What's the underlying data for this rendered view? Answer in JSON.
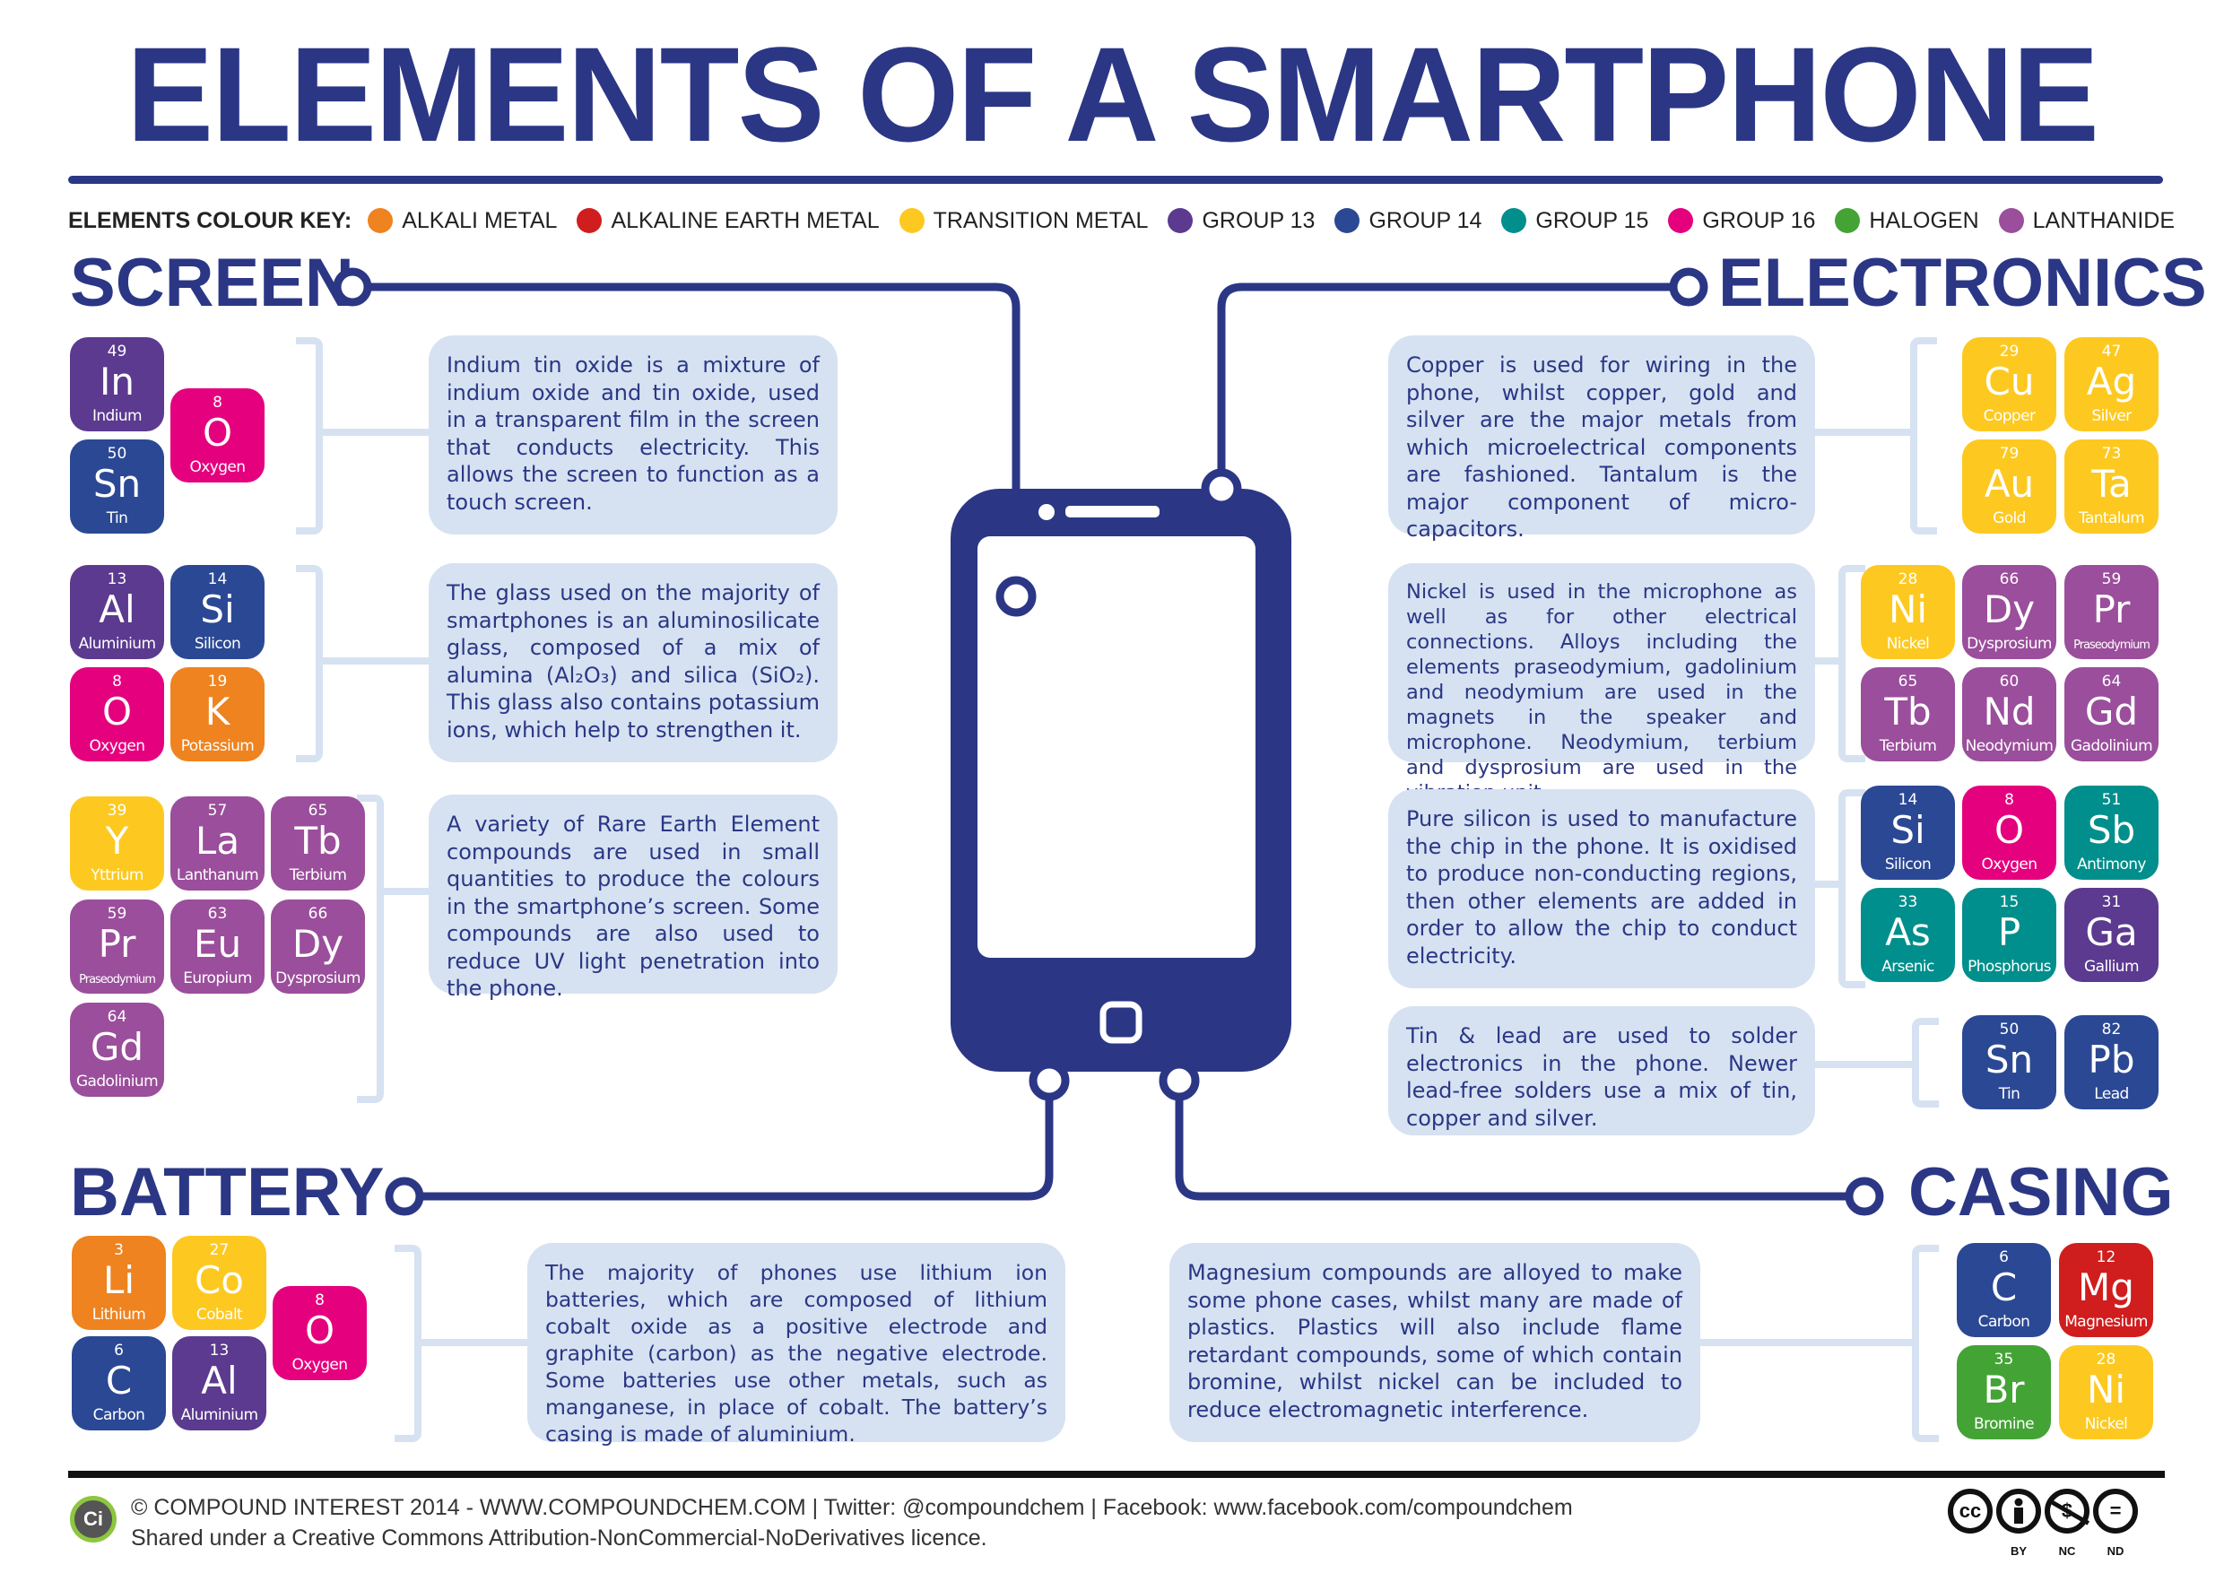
{
  "title": "ELEMENTS OF A SMARTPHONE",
  "colours": {
    "alkali_metal": "#ee8320",
    "alkaline_earth_metal": "#d01d1d",
    "transition_metal": "#fdc921",
    "group_13": "#5b3a8f",
    "group_14": "#2b4894",
    "group_15": "#008f8c",
    "group_16": "#e5007e",
    "halogen": "#44a335",
    "lanthanide": "#9a4e9b",
    "brand": "#2b3785",
    "panel": "#d6e2f1"
  },
  "key": {
    "label": "ELEMENTS COLOUR KEY:",
    "items": [
      {
        "label": "ALKALI METAL",
        "color": "#ee8320"
      },
      {
        "label": "ALKALINE EARTH METAL",
        "color": "#d01d1d"
      },
      {
        "label": "TRANSITION METAL",
        "color": "#fdc921"
      },
      {
        "label": "GROUP 13",
        "color": "#5b3a8f"
      },
      {
        "label": "GROUP 14",
        "color": "#2b4894"
      },
      {
        "label": "GROUP 15",
        "color": "#008f8c"
      },
      {
        "label": "GROUP 16",
        "color": "#e5007e"
      },
      {
        "label": "HALOGEN",
        "color": "#44a335"
      },
      {
        "label": "LANTHANIDE",
        "color": "#9a4e9b"
      }
    ]
  },
  "sections": {
    "screen": {
      "title": "SCREEN",
      "groups": [
        {
          "text": [
            "Indium tin oxide is a mixture of indium oxide and tin oxide, used in a transparent film in the screen that conducts electricity. This allows the screen to function as a touch screen."
          ],
          "elements": [
            {
              "num": "49",
              "sym": "In",
              "name": "Indium",
              "color": "#5b3a8f"
            },
            {
              "num": "50",
              "sym": "Sn",
              "name": "Tin",
              "color": "#2b4894"
            },
            {
              "num": "8",
              "sym": "O",
              "name": "Oxygen",
              "color": "#e5007e"
            }
          ]
        },
        {
          "text": [
            "The glass used on the majority of smartphones is an aluminosilicate glass, composed of a mix of alumina (Al₂O₃) and silica (SiO₂). This glass also contains potassium ions, which help to strengthen it."
          ],
          "elements": [
            {
              "num": "13",
              "sym": "Al",
              "name": "Aluminium",
              "color": "#5b3a8f"
            },
            {
              "num": "14",
              "sym": "Si",
              "name": "Silicon",
              "color": "#2b4894"
            },
            {
              "num": "8",
              "sym": "O",
              "name": "Oxygen",
              "color": "#e5007e"
            },
            {
              "num": "19",
              "sym": "K",
              "name": "Potassium",
              "color": "#ee8320"
            }
          ]
        },
        {
          "text": [
            "A variety of Rare Earth Element compounds are used in small quantities to produce the colours in the smartphone’s screen. Some compounds are also used to reduce UV light penetration into the phone."
          ],
          "elements": [
            {
              "num": "39",
              "sym": "Y",
              "name": "Yttrium",
              "color": "#fdc921"
            },
            {
              "num": "57",
              "sym": "La",
              "name": "Lanthanum",
              "color": "#9a4e9b"
            },
            {
              "num": "65",
              "sym": "Tb",
              "name": "Terbium",
              "color": "#9a4e9b"
            },
            {
              "num": "59",
              "sym": "Pr",
              "name": "Praseodymium",
              "color": "#9a4e9b"
            },
            {
              "num": "63",
              "sym": "Eu",
              "name": "Europium",
              "color": "#9a4e9b"
            },
            {
              "num": "66",
              "sym": "Dy",
              "name": "Dysprosium",
              "color": "#9a4e9b"
            },
            {
              "num": "64",
              "sym": "Gd",
              "name": "Gadolinium",
              "color": "#9a4e9b"
            }
          ]
        }
      ]
    },
    "electronics": {
      "title": "ELECTRONICS",
      "groups": [
        {
          "text": [
            "Copper is used for wiring in the phone, whilst copper, gold and silver are the major metals from which microelectrical components are fashioned. Tantalum is the major component of micro-capacitors."
          ],
          "elements": [
            {
              "num": "29",
              "sym": "Cu",
              "name": "Copper",
              "color": "#fdc921"
            },
            {
              "num": "47",
              "sym": "Ag",
              "name": "Silver",
              "color": "#fdc921"
            },
            {
              "num": "79",
              "sym": "Au",
              "name": "Gold",
              "color": "#fdc921"
            },
            {
              "num": "73",
              "sym": "Ta",
              "name": "Tantalum",
              "color": "#fdc921"
            }
          ]
        },
        {
          "text": [
            "Nickel is used in the microphone as well as for other electrical connections. Alloys including the elements praseodymium, gadolinium and neodymium are used in the magnets in the speaker and microphone. Neodymium, terbium and dysprosium are used in the vibration unit."
          ],
          "elements": [
            {
              "num": "28",
              "sym": "Ni",
              "name": "Nickel",
              "color": "#fdc921"
            },
            {
              "num": "66",
              "sym": "Dy",
              "name": "Dysprosium",
              "color": "#9a4e9b"
            },
            {
              "num": "59",
              "sym": "Pr",
              "name": "Praseodymium",
              "color": "#9a4e9b"
            },
            {
              "num": "65",
              "sym": "Tb",
              "name": "Terbium",
              "color": "#9a4e9b"
            },
            {
              "num": "60",
              "sym": "Nd",
              "name": "Neodymium",
              "color": "#9a4e9b"
            },
            {
              "num": "64",
              "sym": "Gd",
              "name": "Gadolinium",
              "color": "#9a4e9b"
            }
          ]
        },
        {
          "text": [
            "Pure silicon is used to manufacture the chip in the phone. It is oxidised to produce non-conducting regions, then other elements are added in order to allow the chip to conduct electricity."
          ],
          "elements": [
            {
              "num": "14",
              "sym": "Si",
              "name": "Silicon",
              "color": "#2b4894"
            },
            {
              "num": "8",
              "sym": "O",
              "name": "Oxygen",
              "color": "#e5007e"
            },
            {
              "num": "51",
              "sym": "Sb",
              "name": "Antimony",
              "color": "#008f8c"
            },
            {
              "num": "33",
              "sym": "As",
              "name": "Arsenic",
              "color": "#008f8c"
            },
            {
              "num": "15",
              "sym": "P",
              "name": "Phosphorus",
              "color": "#008f8c"
            },
            {
              "num": "31",
              "sym": "Ga",
              "name": "Gallium",
              "color": "#5b3a8f"
            }
          ]
        },
        {
          "text": [
            "Tin & lead are used to solder electronics in the phone. Newer lead-free solders use a mix of tin, copper and silver."
          ],
          "elements": [
            {
              "num": "50",
              "sym": "Sn",
              "name": "Tin",
              "color": "#2b4894"
            },
            {
              "num": "82",
              "sym": "Pb",
              "name": "Lead",
              "color": "#2b4894"
            }
          ]
        }
      ]
    },
    "battery": {
      "title": "BATTERY",
      "groups": [
        {
          "text": [
            "The majority of phones use lithium ion batteries, which are composed of lithium cobalt oxide as a positive electrode and graphite (carbon) as the negative electrode. Some batteries use other metals, such as manganese, in place of cobalt. The battery’s casing is made of aluminium."
          ],
          "elements": [
            {
              "num": "3",
              "sym": "Li",
              "name": "Lithium",
              "color": "#ee8320"
            },
            {
              "num": "27",
              "sym": "Co",
              "name": "Cobalt",
              "color": "#fdc921"
            },
            {
              "num": "6",
              "sym": "C",
              "name": "Carbon",
              "color": "#2b4894"
            },
            {
              "num": "13",
              "sym": "Al",
              "name": "Aluminium",
              "color": "#5b3a8f"
            },
            {
              "num": "8",
              "sym": "O",
              "name": "Oxygen",
              "color": "#e5007e"
            }
          ]
        }
      ]
    },
    "casing": {
      "title": "CASING",
      "groups": [
        {
          "text": [
            "Magnesium compounds are alloyed to make some phone cases, whilst many are made of plastics. Plastics will also include flame retardant compounds, some of which contain bromine, whilst nickel can be included to reduce electromagnetic interference."
          ],
          "elements": [
            {
              "num": "6",
              "sym": "C",
              "name": "Carbon",
              "color": "#2b4894"
            },
            {
              "num": "12",
              "sym": "Mg",
              "name": "Magnesium",
              "color": "#d01d1d"
            },
            {
              "num": "35",
              "sym": "Br",
              "name": "Bromine",
              "color": "#44a335"
            },
            {
              "num": "28",
              "sym": "Ni",
              "name": "Nickel",
              "color": "#fdc921"
            }
          ]
        }
      ]
    }
  },
  "footer": {
    "logo": "Ci",
    "line1": "© COMPOUND INTEREST 2014 - WWW.COMPOUNDCHEM.COM  |  Twitter: @compoundchem  |  Facebook: www.facebook.com/compoundchem",
    "line2": "Shared under a Creative Commons Attribution-NonCommercial-NoDerivatives licence.",
    "cc_badges": [
      {
        "glyph": "cc",
        "label": ""
      },
      {
        "glyph": "person",
        "label": "BY"
      },
      {
        "glyph": "$",
        "label": "NC"
      },
      {
        "glyph": "=",
        "label": "ND"
      }
    ]
  }
}
